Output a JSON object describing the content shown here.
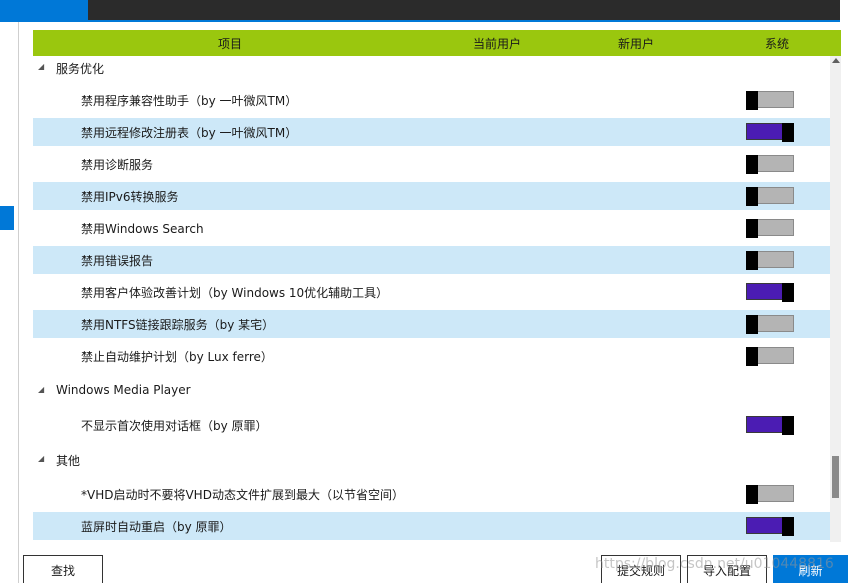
{
  "header": {
    "col_item": "项目",
    "col_current_user": "当前用户",
    "col_new_user": "新用户",
    "col_system": "系统"
  },
  "groups": {
    "service": "服务优化",
    "wmp": "Windows Media Player",
    "other": "其他"
  },
  "items": [
    {
      "label": "禁用程序兼容性助手（by 一叶微风TM）",
      "system_on": false
    },
    {
      "label": "禁用远程修改注册表（by 一叶微风TM）",
      "system_on": true
    },
    {
      "label": "禁用诊断服务",
      "system_on": false
    },
    {
      "label": "禁用IPv6转换服务",
      "system_on": false
    },
    {
      "label": "禁用Windows Search",
      "system_on": false
    },
    {
      "label": "禁用错误报告",
      "system_on": false
    },
    {
      "label": "禁用客户体验改善计划（by Windows 10优化辅助工具）",
      "system_on": true
    },
    {
      "label": "禁用NTFS链接跟踪服务（by 某宅）",
      "system_on": false
    },
    {
      "label": "禁止自动维护计划（by Lux ferre）",
      "system_on": false
    },
    {
      "label": "不显示首次使用对话框（by 原罪）",
      "system_on": true
    },
    {
      "label": "*VHD启动时不要将VHD动态文件扩展到最大（以节省空间）",
      "system_on": false
    },
    {
      "label": "蓝屏时自动重启（by 原罪）",
      "system_on": true
    }
  ],
  "buttons": {
    "find": "查找",
    "submit_rules": "提交规则",
    "import_config": "导入配置",
    "refresh": "刷新"
  },
  "watermark": "https://blog.csdn.net/u010448816",
  "colors": {
    "header_bg": "#9ac70e",
    "alt_row": "#cde8f8",
    "toggle_on": "#4b1cb3",
    "accent": "#0078d7"
  }
}
